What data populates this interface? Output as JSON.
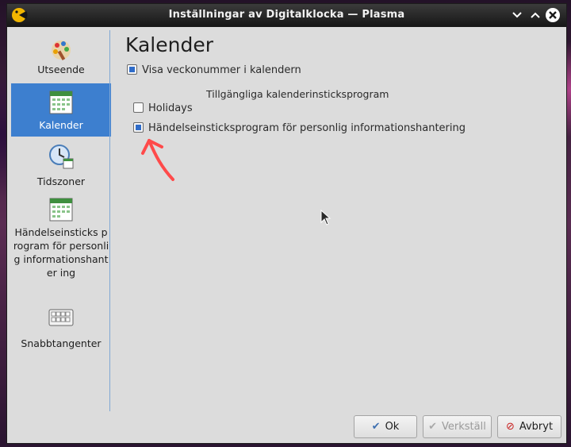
{
  "window": {
    "title": "Inställningar av Digitalklocka — Plasma",
    "controls": [
      "chevron-down-icon",
      "chevron-up-icon",
      "close-icon"
    ]
  },
  "sidebar": {
    "items": [
      {
        "label": "Utseende",
        "icon": "appearance-icon",
        "active": false
      },
      {
        "label": "Kalender",
        "icon": "calendar-icon",
        "active": true
      },
      {
        "label": "Tidszoner",
        "icon": "clock-icon",
        "active": false
      },
      {
        "label": "Händelseinsticks program för personlig informationshanter ing",
        "icon": "calendar-icon",
        "active": false
      },
      {
        "label": "Snabbtangenter",
        "icon": "keyboard-icon",
        "active": false
      }
    ]
  },
  "main": {
    "title": "Kalender",
    "show_week_numbers": {
      "label": "Visa veckonummer i kalendern",
      "checked": true
    },
    "plugins_group": {
      "title": "Tillgängliga kalenderinsticksprogram",
      "plugins": [
        {
          "label": "Holidays",
          "checked": false
        },
        {
          "label": "Händelseinsticksprogram för personlig informationshantering",
          "checked": true
        }
      ]
    }
  },
  "buttons": {
    "ok": "Ok",
    "apply": "Verkställ",
    "cancel": "Avbryt"
  },
  "colors": {
    "accent": "#3d7fcf",
    "checkbox_fill": "#2f6cc9",
    "annotation": "#ff4a4a"
  }
}
